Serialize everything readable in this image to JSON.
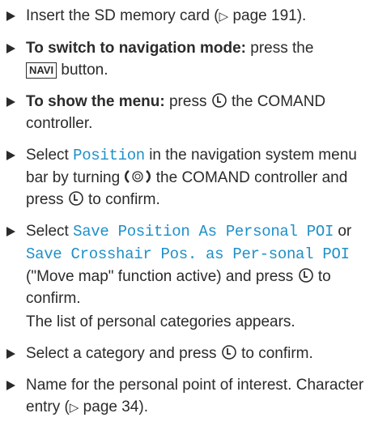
{
  "steps": [
    {
      "pre": "Insert the SD memory card (",
      "ref": "▷",
      "post": " page 191)."
    },
    {
      "bold": "To switch to navigation mode:",
      "pre": " press the",
      "key": "NAVI",
      "post": " button."
    },
    {
      "bold": "To show the menu:",
      "pre": " press",
      "post": " the COMAND controller."
    },
    {
      "pre": "Select ",
      "mono": "Position",
      "mid": " in the navigation system menu bar by turning",
      "mid2": " the COMAND controller and press",
      "post": " to confirm."
    },
    {
      "pre": "Select ",
      "mono1": "Save Position As Personal POI",
      "mid": " or ",
      "mono2": "Save Crosshair Pos. as Per-sonal POI",
      "mid2": " (\"Move map\" function active) and press",
      "post": " to confirm.",
      "note": "The list of personal categories appears."
    },
    {
      "pre": "Select a category and press",
      "post": " to confirm."
    },
    {
      "pre": "Name for the personal point of interest. Character entry (",
      "ref": "▷",
      "post": " page 34)."
    }
  ],
  "icons": {
    "press": "press-controller-icon",
    "turn": "turn-controller-icon"
  }
}
